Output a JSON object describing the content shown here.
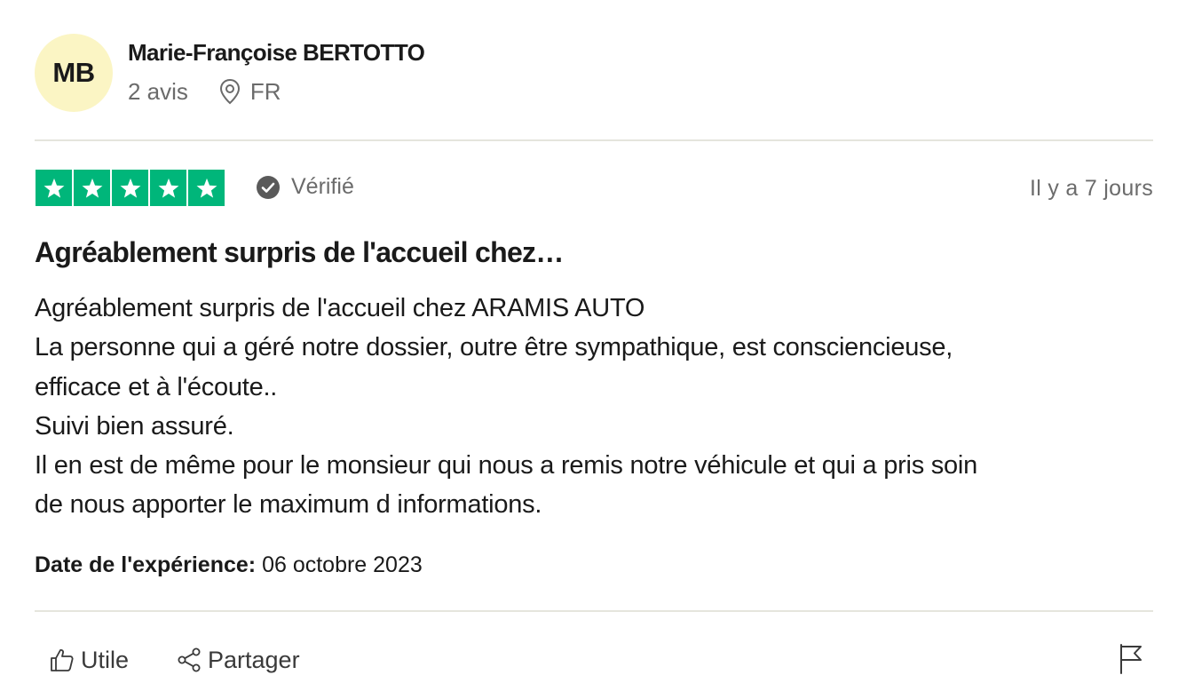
{
  "reviewer": {
    "initials": "MB",
    "name": "Marie-Françoise BERTOTTO",
    "review_count": "2 avis",
    "country": "FR",
    "avatar_color": "#fbf5c4"
  },
  "rating": {
    "stars": 5,
    "max_stars": 5,
    "star_color": "#00b67a",
    "verified_label": "Vérifié",
    "relative_date": "Il y a 7 jours"
  },
  "review": {
    "title": "Agréablement surpris de l'accueil chez…",
    "body_lines": [
      "Agréablement surpris de l'accueil chez ARAMIS AUTO",
      "La personne qui a géré notre dossier, outre être sympathique, est consciencieuse,",
      "efficace et à l'écoute..",
      "Suivi bien assuré.",
      "Il en est de même pour le monsieur qui nous a remis notre véhicule et qui a pris soin",
      "de nous apporter le maximum d informations."
    ],
    "experience_label": "Date de l'expérience:",
    "experience_date": "06 octobre 2023"
  },
  "actions": {
    "useful_label": "Utile",
    "share_label": "Partager",
    "useful_icon": "thumbs-up-icon",
    "share_icon": "share-icon",
    "report_icon": "flag-icon"
  }
}
